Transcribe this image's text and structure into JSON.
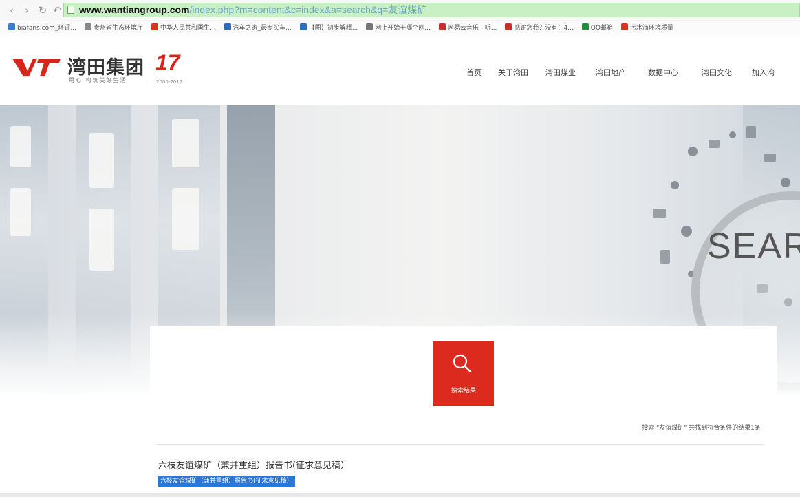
{
  "browser": {
    "url_host": "www.wantiangroup.com",
    "url_path": "/index.php?m=content&c=index&a=search&q=友谊煤矿",
    "back_icon": "chevron-left-icon",
    "forward_icon": "chevron-right-icon",
    "refresh_icon": "refresh-icon",
    "undo_icon": "undo-icon",
    "bookmarks": [
      {
        "label": "biafans.com_环评...",
        "icon_color": "#3b7fd1"
      },
      {
        "label": "贵州省生态环境厅",
        "icon_color": "#888888"
      },
      {
        "label": "中华人民共和国生...",
        "icon_color": "#d8351f"
      },
      {
        "label": "汽车之家_最专买车...",
        "icon_color": "#2a6fb8"
      },
      {
        "label": "【图】初步解释...",
        "icon_color": "#2a6fb8"
      },
      {
        "label": "网上开始于哪个网...",
        "icon_color": "#777777"
      },
      {
        "label": "网易云音乐 - 听...",
        "icon_color": "#c8302a"
      },
      {
        "label": "感谢您我？没有：4...",
        "icon_color": "#c8302a"
      },
      {
        "label": "QQ邮箱",
        "icon_color": "#1f8f3a"
      },
      {
        "label": "污水海环境质量",
        "icon_color": "#d8351f"
      }
    ]
  },
  "site": {
    "logo_text": "湾田集团",
    "logo_slogan": "用心 构筑美好生活",
    "logo_anniversary": "17",
    "logo_years": "2000-2017",
    "nav": [
      "首页",
      "关于湾田",
      "湾田煤业",
      "湾田地产",
      "数据中心",
      "湾田文化",
      "加入湾"
    ]
  },
  "banner": {
    "search_word": "SEAR"
  },
  "results": {
    "badge_label": "搜索结果",
    "summary": "搜索 \"友谊煤矿\" 共找到符合条件的结果1条",
    "items": [
      {
        "title": "六枝友谊煤矿（兼并重组）报告书(征求意见稿）",
        "snippet": "六枝友谊煤矿（兼并重组）报告书(征求意见稿）"
      }
    ]
  },
  "colors": {
    "brand_red": "#dc2a1f",
    "url_bar_green": "#c9efc4",
    "selection_blue": "#2a77d6"
  }
}
